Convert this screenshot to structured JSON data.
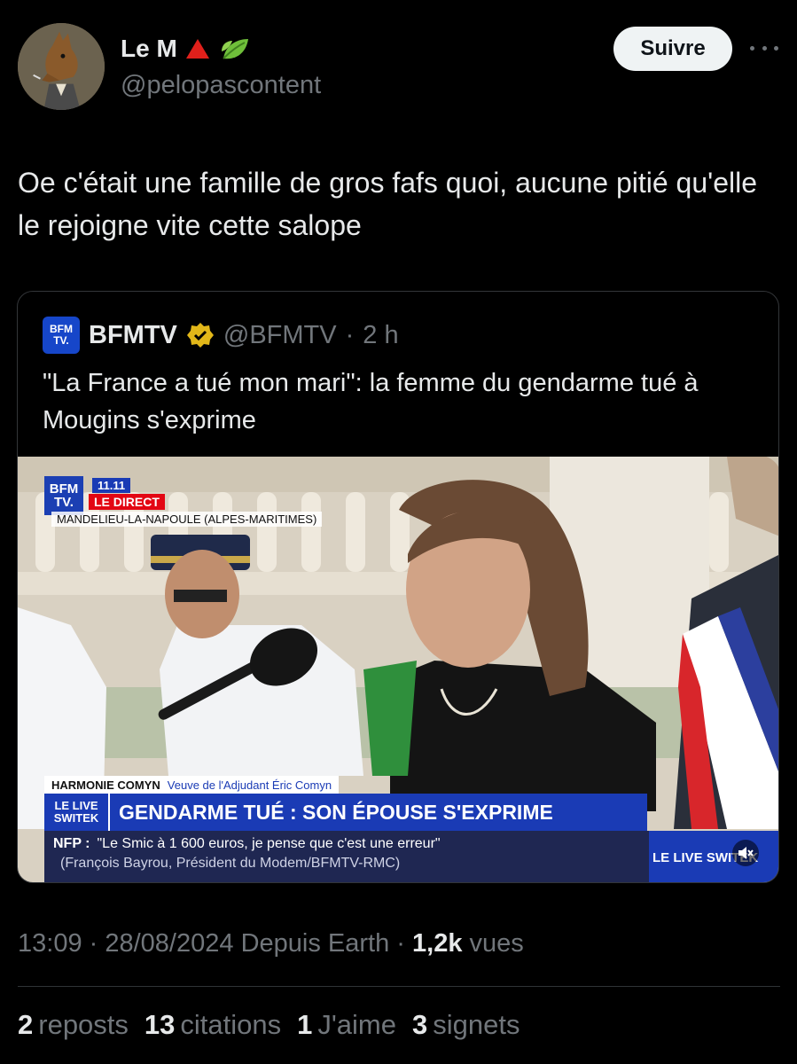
{
  "author": {
    "name": "Le M",
    "handle": "@pelopascontent",
    "follow_label": "Suivre",
    "avatar_icon": "horse-avatar-icon"
  },
  "tweet": {
    "text": "Oe c'était une famille de gros fafs quoi, aucune pitié qu'elle le rejoigne vite cette salope",
    "time": "13:09",
    "date": "28/08/2024",
    "source": "Depuis Earth",
    "views_count": "1,2k",
    "views_label": "vues"
  },
  "quote": {
    "name": "BFMTV",
    "handle": "@BFMTV",
    "age": "2 h",
    "text": "\"La France a tué mon mari\": la femme du gendarme tué à Mougins s'exprime",
    "logo_l1": "BFM",
    "logo_l2": "TV."
  },
  "video": {
    "channel_l1": "BFM",
    "channel_l2": "TV.",
    "time_badge": "11.11",
    "direct_badge": "LE DIRECT",
    "location": "MANDELIEU-LA-NAPOULE (ALPES-MARITIMES)",
    "person_name": "HARMONIE COMYN",
    "person_role": "Veuve de l'Adjudant Éric Comyn",
    "live_tag_l1": "LE LIVE",
    "live_tag_l2": "SWITEK",
    "headline": "GENDARME TUÉ : SON ÉPOUSE S'EXPRIME",
    "ticker_prefix": "NFP :",
    "ticker_quote": "\"Le Smic à 1 600 euros, je pense que c'est une erreur\"",
    "ticker_source": "(François Bayrou, Président du Modem/BFMTV-RMC)",
    "live_right": "LE LIVE SWITEK",
    "mute_icon": "speaker-muted-icon"
  },
  "stats": {
    "reposts_count": "2",
    "reposts_label": "reposts",
    "quotes_count": "13",
    "quotes_label": "citations",
    "likes_count": "1",
    "likes_label": "J'aime",
    "bookmarks_count": "3",
    "bookmarks_label": "signets"
  },
  "colors": {
    "background": "#000000",
    "text": "#e7e9ea",
    "muted": "#71767b",
    "bfm_blue": "#1a3bb5",
    "bfm_red": "#e30613"
  }
}
